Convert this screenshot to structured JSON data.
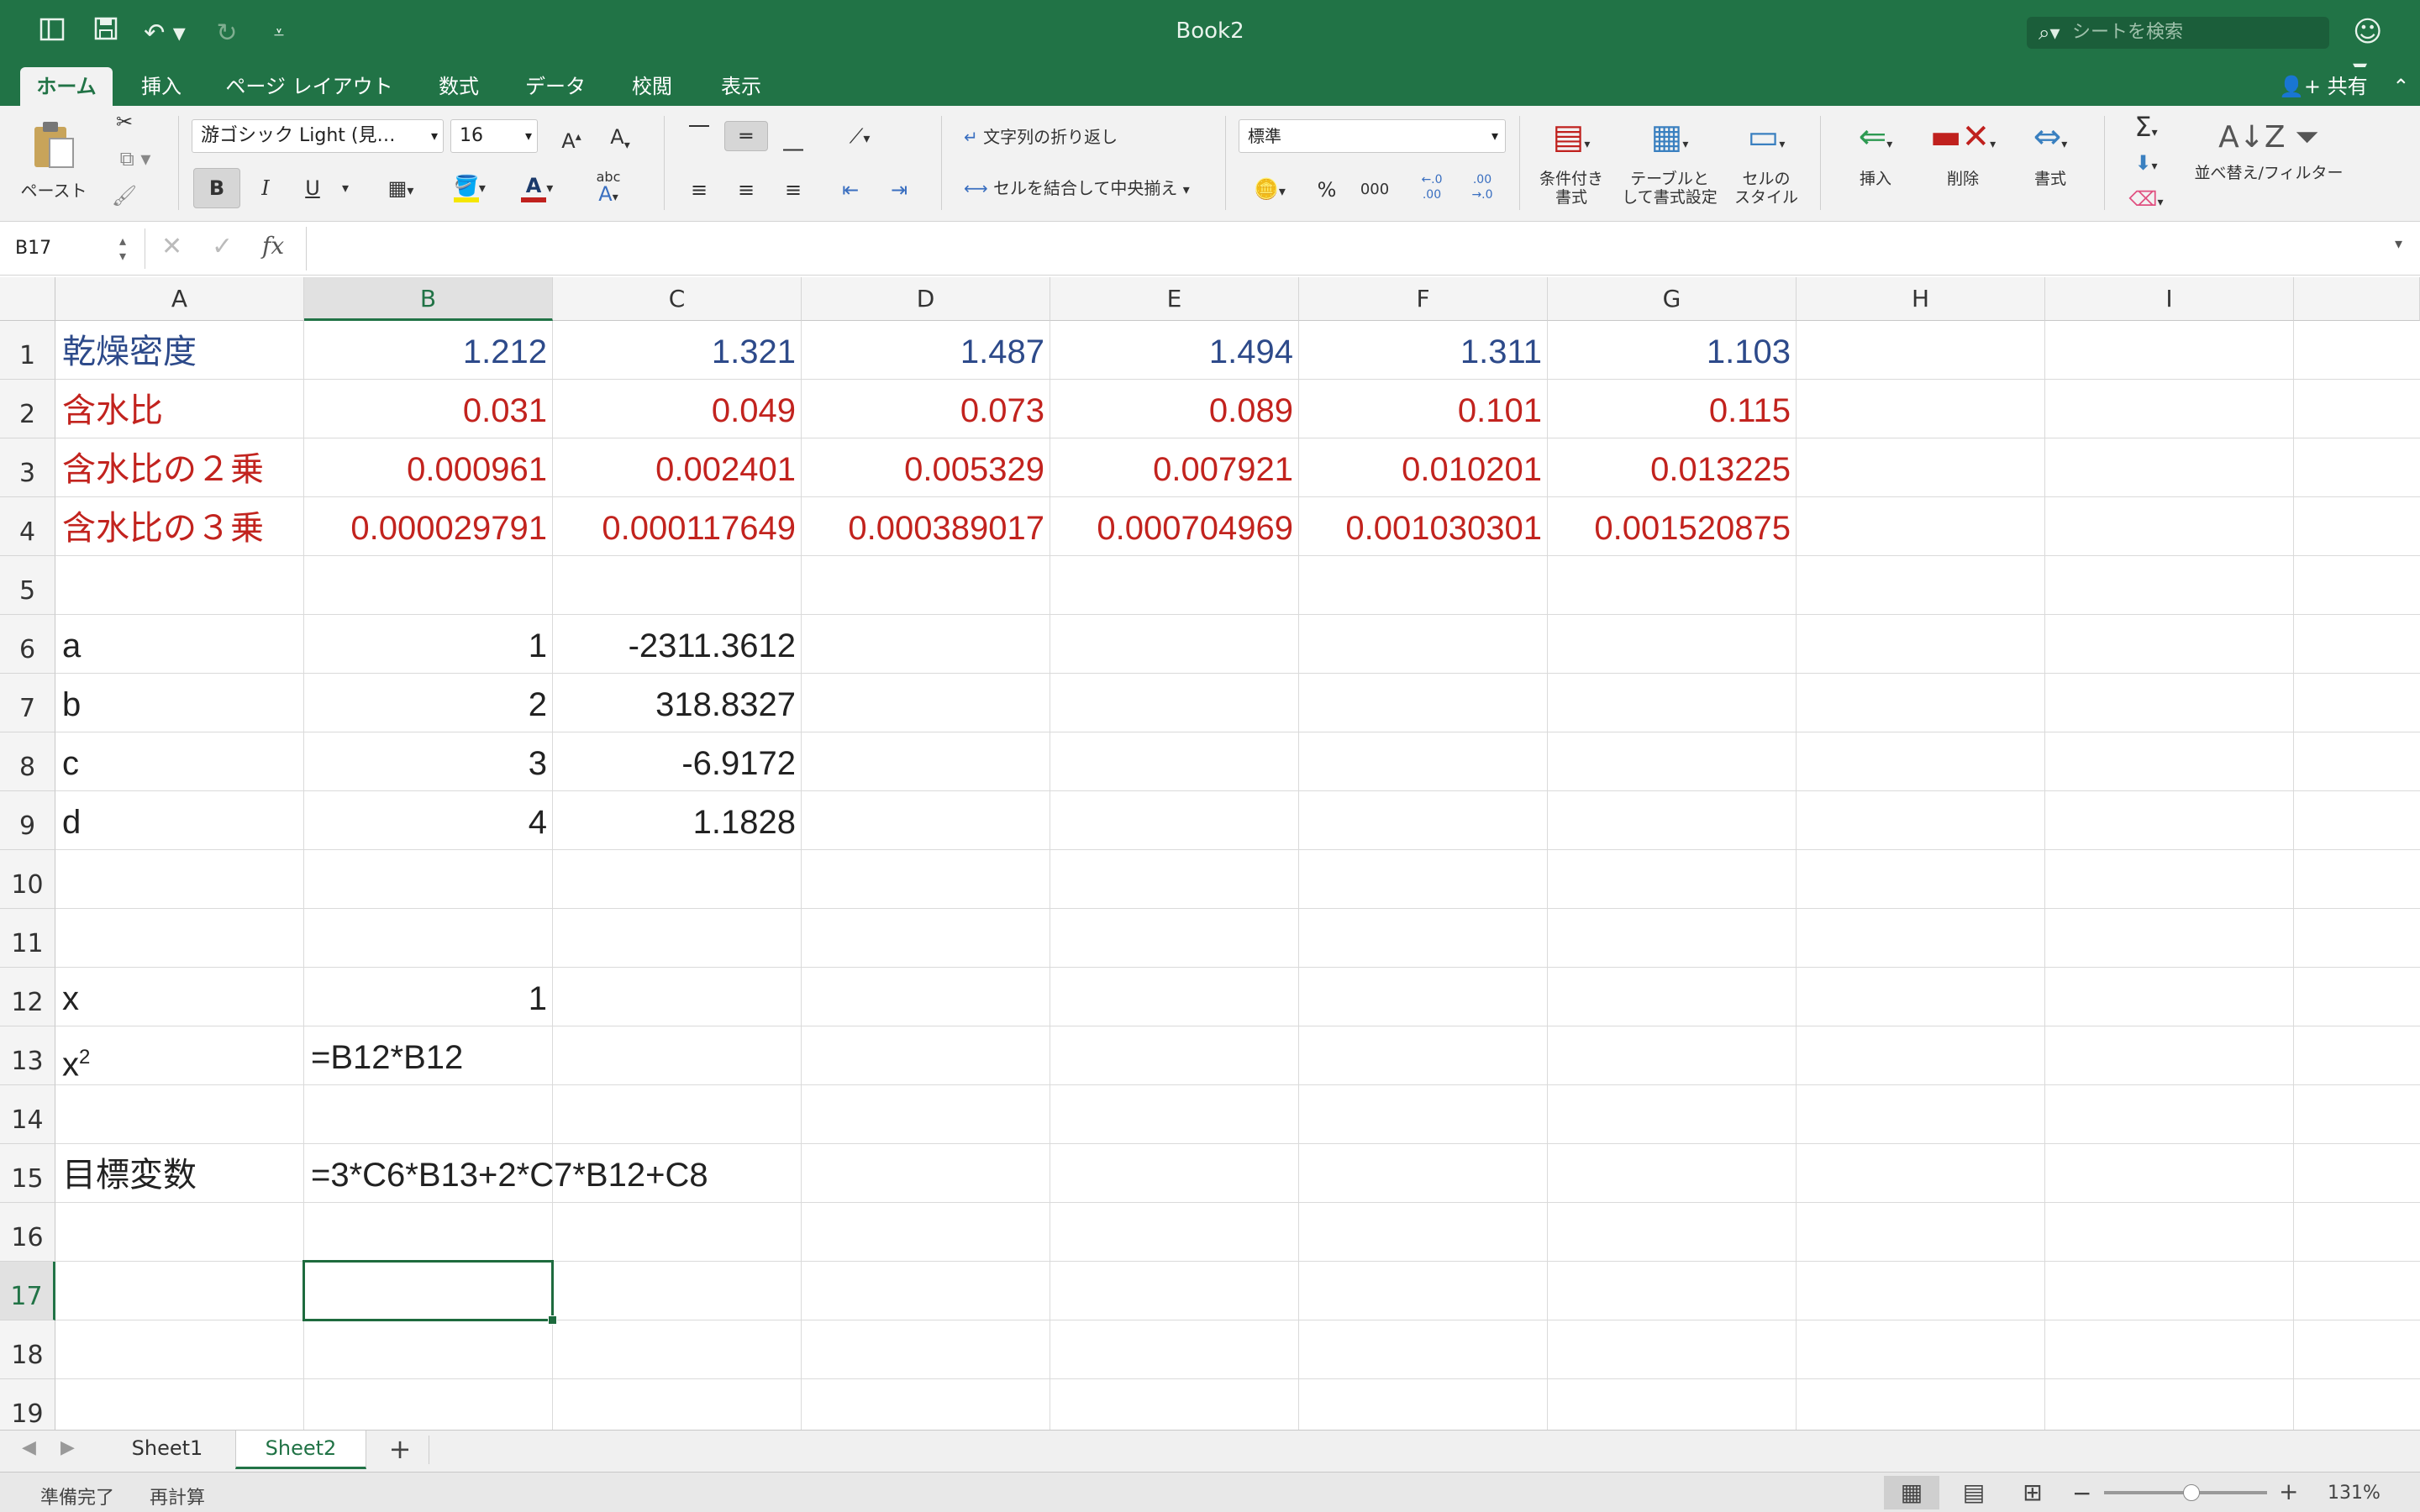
{
  "titlebar": {
    "title": "Book2",
    "search_placeholder": "シートを検索",
    "quick_access": [
      "sidebar-toggle",
      "save",
      "undo",
      "redo",
      "customize"
    ]
  },
  "tabs": [
    "ホーム",
    "挿入",
    "ページ レイアウト",
    "数式",
    "データ",
    "校閲",
    "表示"
  ],
  "share_label": "共有",
  "ribbon": {
    "paste_label": "ペースト",
    "font_name": "游ゴシック Light (見…",
    "font_size": "16",
    "wrap_text": "文字列の折り返し",
    "merge_center": "セルを結合して中央揃え",
    "number_format": "標準",
    "percent": "%",
    "thousands": "000",
    "cond_format": [
      "条件付き",
      "書式"
    ],
    "table_format": [
      "テーブルと",
      "して書式設定"
    ],
    "cell_style": [
      "セルの",
      "スタイル"
    ],
    "insert": "挿入",
    "delete": "削除",
    "format": "書式",
    "sort_filter": "並べ替え/フィルター",
    "bold": "B",
    "italic": "I",
    "underline": "U",
    "abc": "abc"
  },
  "formula_bar": {
    "name_box": "B17",
    "fx": "fx",
    "content": ""
  },
  "grid": {
    "columns": [
      "A",
      "B",
      "C",
      "D",
      "E",
      "F",
      "G",
      "H",
      "I"
    ],
    "rows": [
      "1",
      "2",
      "3",
      "4",
      "5",
      "6",
      "7",
      "8",
      "9",
      "10",
      "11",
      "12",
      "13",
      "14",
      "15",
      "16",
      "17",
      "18",
      "19"
    ],
    "selected_cell": "B17",
    "cells": {
      "A1": "乾燥密度",
      "B1": "1.212",
      "C1": "1.321",
      "D1": "1.487",
      "E1": "1.494",
      "F1": "1.311",
      "G1": "1.103",
      "A2": "含水比",
      "B2": "0.031",
      "C2": "0.049",
      "D2": "0.073",
      "E2": "0.089",
      "F2": "0.101",
      "G2": "0.115",
      "A3": "含水比の２乗",
      "B3": "0.000961",
      "C3": "0.002401",
      "D3": "0.005329",
      "E3": "0.007921",
      "F3": "0.010201",
      "G3": "0.013225",
      "A4": "含水比の３乗",
      "B4": "0.000029791",
      "C4": "0.000117649",
      "D4": "0.000389017",
      "E4": "0.000704969",
      "F4": "0.001030301",
      "G4": "0.001520875",
      "A6": "a",
      "B6": "1",
      "C6": "-2311.3612",
      "A7": "b",
      "B7": "2",
      "C7": "318.8327",
      "A8": "c",
      "B8": "3",
      "C8": "-6.9172",
      "A9": "d",
      "B9": "4",
      "C9": "1.1828",
      "A12": "x",
      "B12": "1",
      "A13": "x",
      "A13_sup": "2",
      "B13": "=B12*B12",
      "A15": "目標変数",
      "B15": "=3*C6*B13+2*C7*B12+C8"
    },
    "colors": {
      "row1": "#2d4a8a",
      "rows2to4": "#c2231e"
    }
  },
  "sheets": [
    "Sheet1",
    "Sheet2"
  ],
  "active_sheet": "Sheet2",
  "status": {
    "ready": "準備完了",
    "recalc": "再計算",
    "zoom": "131%"
  }
}
